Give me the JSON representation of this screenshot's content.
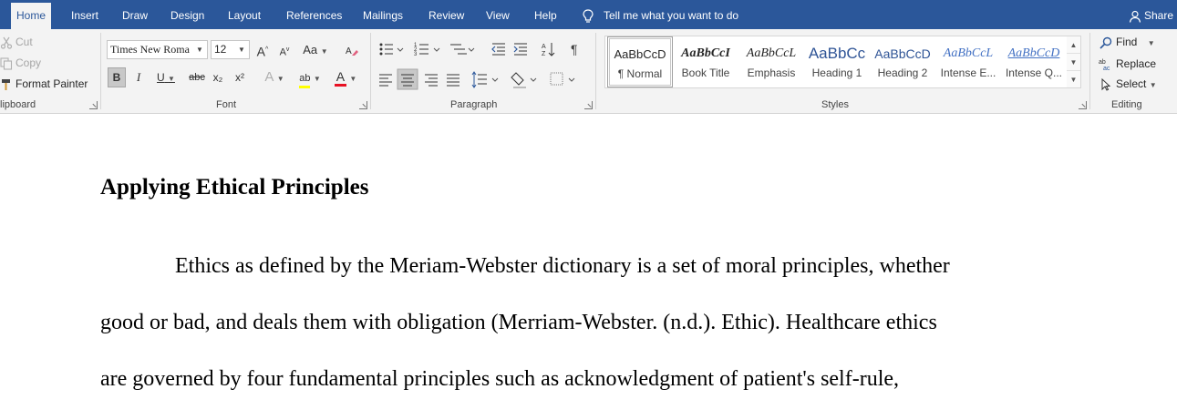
{
  "tabs": [
    {
      "label": "Home",
      "active": true
    },
    {
      "label": "Insert"
    },
    {
      "label": "Draw"
    },
    {
      "label": "Design"
    },
    {
      "label": "Layout"
    },
    {
      "label": "References"
    },
    {
      "label": "Mailings"
    },
    {
      "label": "Review"
    },
    {
      "label": "View"
    },
    {
      "label": "Help"
    }
  ],
  "tell_me": "Tell me what you want to do",
  "share": "Share",
  "clipboard": {
    "cut": "Cut",
    "copy": "Copy",
    "format_painter": "Format Painter",
    "label": "lipboard"
  },
  "font": {
    "name": "Times New Roma",
    "size": "12",
    "label": "Font",
    "bold": "B",
    "italic": "I",
    "underline": "U",
    "strike": "abc",
    "subscript": "x₂",
    "superscript": "x²",
    "grow": "A",
    "shrink": "A",
    "change_case": "Aa",
    "font_color": "A",
    "highlight": "ab"
  },
  "paragraph": {
    "label": "Paragraph",
    "pilcrow": "¶"
  },
  "styles": {
    "label": "Styles",
    "items": [
      {
        "sample": "AaBbCcD",
        "name": "¶ Normal"
      },
      {
        "sample": "AaBbCcI",
        "name": "Book Title"
      },
      {
        "sample": "AaBbCcL",
        "name": "Emphasis"
      },
      {
        "sample": "AaBbCс",
        "name": "Heading 1"
      },
      {
        "sample": "AaBbCcD",
        "name": "Heading 2"
      },
      {
        "sample": "AaBbCcL",
        "name": "Intense E..."
      },
      {
        "sample": "AaBbCcD",
        "name": "Intense Q..."
      }
    ]
  },
  "editing": {
    "label": "Editing",
    "find": "Find",
    "replace": "Replace",
    "select": "Select"
  },
  "colors": {
    "brand": "#2b579a",
    "font_color": "#e81123",
    "highlight": "#ffff00",
    "heading_blue": "#2f5496"
  },
  "document": {
    "heading": "Applying Ethical Principles",
    "lines": [
      "Ethics as defined by the Meriam-Webster dictionary is a set of moral principles, whether",
      "good or bad, and deals them with obligation (Merriam-Webster. (n.d.). Ethic). Healthcare ethics",
      "are governed by four fundamental principles such as acknowledgment of patient's self-rule,"
    ]
  }
}
